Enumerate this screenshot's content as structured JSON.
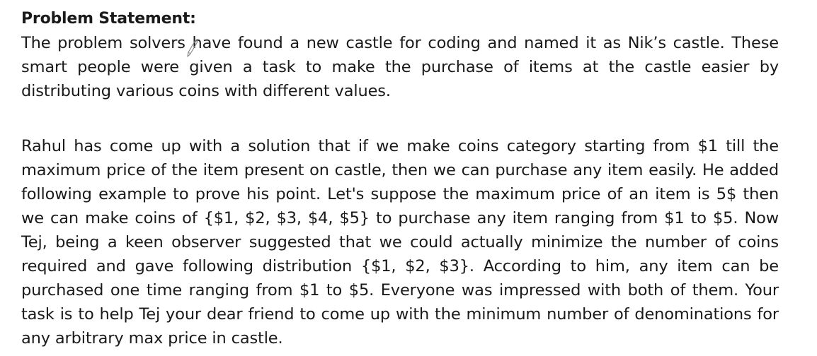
{
  "document": {
    "heading": "Problem Statement:",
    "paragraphs": [
      "The problem solvers have found a new castle for coding and named it as Nik’s castle. These smart people were given a task to make the purchase of items at the castle easier by distributing various coins with different values.",
      "Rahul has come up with a solution that if we make coins category starting from $1 till the maximum price of the item present on castle, then we can purchase any item easily. He added following example to prove his point. Let's suppose the maximum price of an item is 5$ then we can make coins of {$1, $2, $3, $4, $5} to purchase any item ranging from $1 to $5. Now Tej, being a keen observer suggested that we could actually minimize the number of coins required and gave following distribution {$1, $2, $3}. According to him, any item can be purchased one time ranging from $1 to $5. Everyone was impressed with both of them. Your task is to help Tej your dear friend to come up with the minimum number of denominations for any arbitrary max price in castle."
    ]
  },
  "cursor": {
    "icon": "pen-cursor-icon"
  }
}
